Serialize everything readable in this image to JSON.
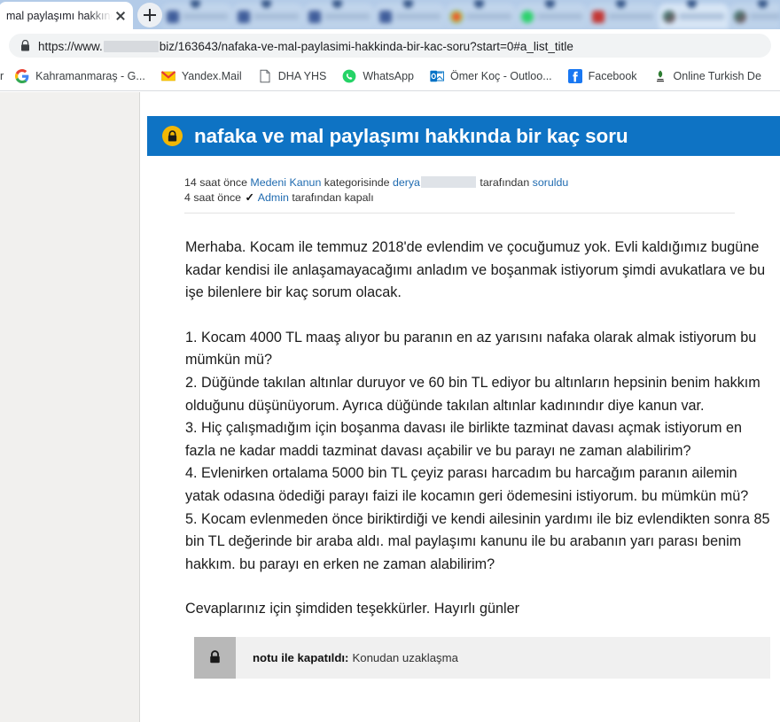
{
  "browser": {
    "active_tab": {
      "title": "mal paylaşımı hakkında",
      "close_icon": "close-icon"
    },
    "new_tab_label": "+",
    "background_tabs_count": 9,
    "omnibox": {
      "security_icon": "lock-icon",
      "url_prefix": "https://www.",
      "url_redacted": true,
      "url_suffix": "biz/163643/nafaka-ve-mal-paylasimi-hakkinda-bir-kac-soru?start=0#a_list_title"
    },
    "bookmarks": [
      {
        "label": "r",
        "icon": "generic-icon"
      },
      {
        "label": "Kahramanmaraş - G...",
        "icon": "google-icon"
      },
      {
        "label": "Yandex.Mail",
        "icon": "yandex-mail-icon"
      },
      {
        "label": "DHA YHS",
        "icon": "page-icon"
      },
      {
        "label": "WhatsApp",
        "icon": "whatsapp-icon"
      },
      {
        "label": "Ömer Koç - Outloo...",
        "icon": "outlook-icon"
      },
      {
        "label": "Facebook",
        "icon": "facebook-icon"
      },
      {
        "label": "Online Turkish De",
        "icon": "turkish-dictionary-icon"
      }
    ]
  },
  "page": {
    "banner": {
      "lock_icon": "lock-icon",
      "title": "nafaka ve mal paylaşımı hakkında bir kaç soru",
      "color": "#0e73c4",
      "lock_badge_color": "#f2b705"
    },
    "meta": {
      "line1_time": "14 saat önce",
      "line1_category": "Medeni Kanun",
      "line1_mid": "kategorisinde",
      "line1_user": "derya",
      "line1_user_redacted": true,
      "line1_by": "tarafından",
      "line1_action": "soruldu",
      "line2_time": "4 saat önce",
      "line2_check_icon": "check-icon",
      "line2_user": "Admin",
      "line2_rest": "tarafından kapalı",
      "link_color": "#1f6bb0"
    },
    "avatar": {
      "icon": "avatar-placeholder-icon",
      "alt": "anonymous user avatar"
    },
    "body": {
      "intro": "Merhaba. Kocam ile temmuz 2018'de evlendim ve çocuğumuz yok. Evli kaldığımız bugüne kadar kendisi ile anlaşamayacağımı anladım ve boşanmak istiyorum şimdi avukatlara ve bu işe bilenlere bir kaç sorum olacak.",
      "q1": "1. Kocam 4000 TL maaş alıyor bu paranın en az yarısını nafaka olarak almak istiyorum bu mümkün mü?",
      "q2": "2. Düğünde takılan altınlar duruyor ve 60 bin TL ediyor bu altınların hepsinin benim hakkım olduğunu düşünüyorum. Ayrıca düğünde takılan altınlar kadınındır diye kanun var.",
      "q3": "3. Hiç çalışmadığım için boşanma davası ile birlikte tazminat davası açmak istiyorum en fazla ne kadar maddi tazminat davası açabilir ve bu parayı ne zaman alabilirim?",
      "q4": "4. Evlenirken ortalama 5000 bin TL çeyiz parası harcadım bu harcağım paranın ailemin yatak odasına ödediği parayı faizi ile kocamın geri ödemesini istiyorum. bu mümkün mü?",
      "q5": "5. Kocam evlenmeden önce biriktirdiği ve kendi ailesinin yardımı ile biz evlendikten sonra 85 bin TL değerinde bir araba aldı. mal paylaşımı kanunu ile bu arabanın yarı parası benim hakkım. bu parayı en erken ne zaman alabilirim?",
      "closing": "Cevaplarınız için şimdiden teşekkürler. Hayırlı günler"
    },
    "closed_note": {
      "lock_icon": "lock-icon",
      "label": "notu ile kapatıldı:",
      "reason": "Konudan uzaklaşma"
    }
  }
}
